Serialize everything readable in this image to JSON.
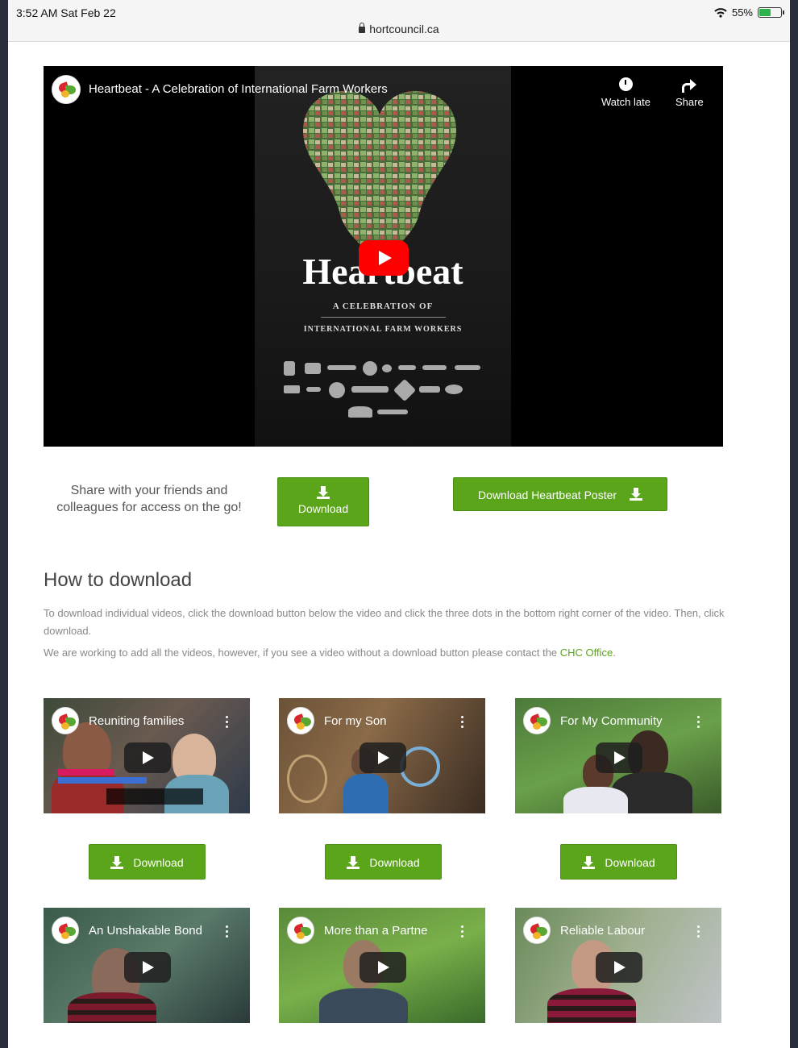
{
  "status": {
    "time": "3:52 AM   Sat Feb 22",
    "battery": "55%",
    "battery_level": 0.55,
    "url": "hortcouncil.ca"
  },
  "main_video": {
    "title": "Heartbeat - A Celebration of International Farm Workers",
    "watch_later": "Watch late",
    "share": "Share",
    "poster_title": "Heartbeat",
    "poster_sub1": "A CELEBRATION OF",
    "poster_sub2": "INTERNATIONAL FARM WORKERS"
  },
  "share_text": "Share with your friends and colleagues for access on the go!",
  "download_label": "Download",
  "poster_btn": "Download Heartbeat Poster",
  "howto": {
    "title": "How to download",
    "p1": "To download individual videos, click the download button below the video and click the three dots in the bottom right corner of the video. Then, click download.",
    "p2_prefix": "We are working to add all the videos, however, if you see a video without a download button please contact the ",
    "p2_link": "CHC Office",
    "p2_suffix": "."
  },
  "videos": [
    {
      "title": "Reuniting families"
    },
    {
      "title": "For my Son"
    },
    {
      "title": "For My Community"
    },
    {
      "title": "An Unshakable Bond"
    },
    {
      "title": "More than a Partne"
    },
    {
      "title": "Reliable Labour"
    }
  ],
  "icons": {
    "status": [
      "wifi-icon",
      "battery-icon",
      "lock-icon"
    ],
    "video": [
      "channel-logo-icon",
      "clock-icon",
      "share-icon",
      "play-icon",
      "more-icon"
    ],
    "button": "download-icon"
  },
  "colors": {
    "accent": "#5aa51a",
    "link": "#5aa51a",
    "youtube_red": "#ff0000"
  }
}
